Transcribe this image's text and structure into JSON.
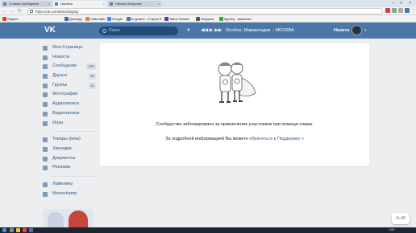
{
  "browser": {
    "tabs": [
      {
        "label": "2 новых сообщения"
      },
      {
        "label": "Ошибка"
      },
      {
        "label": "Никита Оборотов"
      }
    ],
    "url": "https://vk.com/linkz/display",
    "bookmarks": [
      "Яндекс",
      "Дискорд",
      "Пайплайн",
      "Google",
      "В уровне - Старая З",
      "Tattoo Russia",
      "Загрузки",
      "Курьер - вакансии"
    ]
  },
  "header": {
    "logo": "VK",
    "search_placeholder": "Поиск",
    "track": "Особое, Мармеладов – МОСКВА",
    "user_name": "Никита"
  },
  "sidebar": {
    "items": [
      {
        "label": "Моя Страница",
        "icon": "home-icon"
      },
      {
        "label": "Новости",
        "icon": "news-icon"
      },
      {
        "label": "Сообщения",
        "icon": "message-icon",
        "count": "225"
      },
      {
        "label": "Друзья",
        "icon": "friends-icon",
        "count": "60"
      },
      {
        "label": "Группы",
        "icon": "groups-icon",
        "count": "12"
      },
      {
        "label": "Фотографии",
        "icon": "photo-icon"
      },
      {
        "label": "Аудиозаписи",
        "icon": "audio-icon"
      },
      {
        "label": "Видеозаписи",
        "icon": "video-icon"
      },
      {
        "label": "Игры",
        "icon": "games-icon"
      }
    ],
    "items2": [
      {
        "label": "Товары (beta)",
        "icon": "goods-icon"
      },
      {
        "label": "Закладки",
        "icon": "bookmark-icon"
      },
      {
        "label": "Документы",
        "icon": "docs-icon"
      },
      {
        "label": "Реклама",
        "icon": "ads-icon"
      }
    ],
    "items3": [
      {
        "label": "Лайкомер",
        "icon": "app-icon"
      },
      {
        "label": "Monochamp",
        "icon": "app-icon"
      }
    ]
  },
  "content": {
    "blocked_message": "Сообщество заблокировано за привлечение участников при помощи спама.",
    "support_prefix": "За подробной информацией Вы можете ",
    "support_link": "обратиться в Поддержку »"
  },
  "chat": {
    "count": "40"
  },
  "taskbar": {
    "clock": "1:58"
  },
  "colors": {
    "vk_blue": "#4a76a8",
    "link": "#2a5885",
    "background": "#edeef0"
  }
}
